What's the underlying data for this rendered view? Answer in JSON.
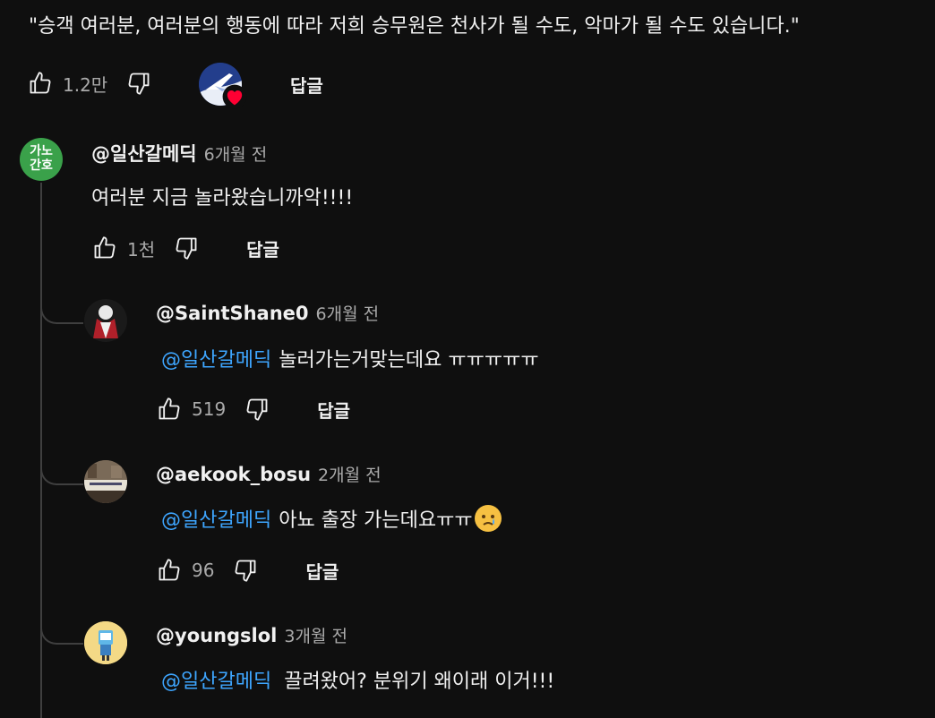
{
  "top_comment": {
    "text": "\"승객 여러분, 여러분의 행동에 따라 저희 승무원은 천사가 될 수도, 악마가 될 수도 있습니다.\"",
    "likes": "1.2만",
    "reply_label": "답글"
  },
  "replies": [
    {
      "author": "@일산갈메딕",
      "time": "6개월 전",
      "mention": "",
      "text": "여러분 지금 놀라왔습니까악!!!!",
      "likes": "1천",
      "reply_label": "답글",
      "avatar_text_top": "가노",
      "avatar_text_bottom": "간호"
    },
    {
      "author": "@SaintShane0",
      "time": "6개월 전",
      "mention": "@일산갈메딕",
      "text": "놀러가는거맞는데요 ㅠㅠㅠㅠㅠ",
      "likes": "519",
      "reply_label": "답글"
    },
    {
      "author": "@aekook_bosu",
      "time": "2개월 전",
      "mention": "@일산갈메딕",
      "text": "아뇨 출장 가는데요ㅠㅠ",
      "emoji": "crying-face",
      "likes": "96",
      "reply_label": "답글"
    },
    {
      "author": "@youngslol",
      "time": "3개월 전",
      "mention": "@일산갈메딕",
      "text": "끌려왔어? 분위기 왜이래 이거!!!"
    }
  ],
  "colors": {
    "background": "#0f0f0f",
    "text": "#f1f1f1",
    "secondary_text": "#aaaaaa",
    "mention": "#3ea6ff",
    "heart": "#ff0033",
    "thread_line": "#3f3f3f"
  }
}
